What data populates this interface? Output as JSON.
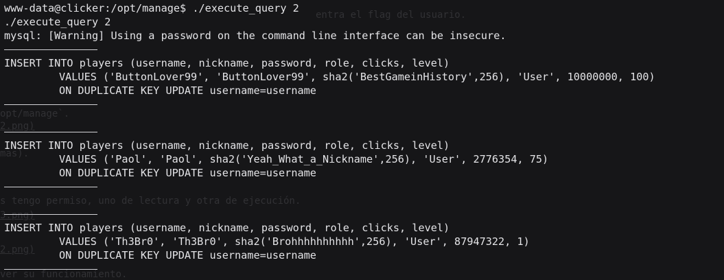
{
  "terminal": {
    "prompt": "www-data@clicker:/opt/manage$",
    "command": " ./execute_query 2",
    "echo": "./execute_query 2",
    "warning": "mysql: [Warning] Using a password on the command line interface can be insecure."
  },
  "queries": [
    {
      "insert": "INSERT INTO players (username, nickname, password, role, clicks, level)",
      "values": "VALUES ('ButtonLover99', 'ButtonLover99', sha2('BestGameinHistory',256), 'User', 10000000, 100)",
      "on_dup": "ON DUPLICATE KEY UPDATE username=username"
    },
    {
      "insert": "INSERT INTO players (username, nickname, password, role, clicks, level)",
      "values": "VALUES ('Paol', 'Paol', sha2('Yeah_What_a_Nickname',256), 'User', 2776354, 75)",
      "on_dup": "ON DUPLICATE KEY UPDATE username=username"
    },
    {
      "insert": "INSERT INTO players (username, nickname, password, role, clicks, level)",
      "values": "VALUES ('Th3Br0', 'Th3Br0', sha2('Brohhhhhhhhhh',256), 'User', 87947322, 1)",
      "on_dup": "ON DUPLICATE KEY UPDATE username=username"
    }
  ],
  "background_text": {
    "line1": "entra el flag del usuario.",
    "line2": "opt/manage`.",
    "line3": "2.png)",
    "line4": "mas).",
    "line5": "s tengo permiso, uno de lectura y otra de ejecución.",
    "line6": "3.png)",
    "line7": "2.png)",
    "line8": "ver su funcionamiento."
  },
  "colors": {
    "background": "#161618",
    "foreground": "#e4e4e7",
    "ghost": "#3a3a3e"
  }
}
